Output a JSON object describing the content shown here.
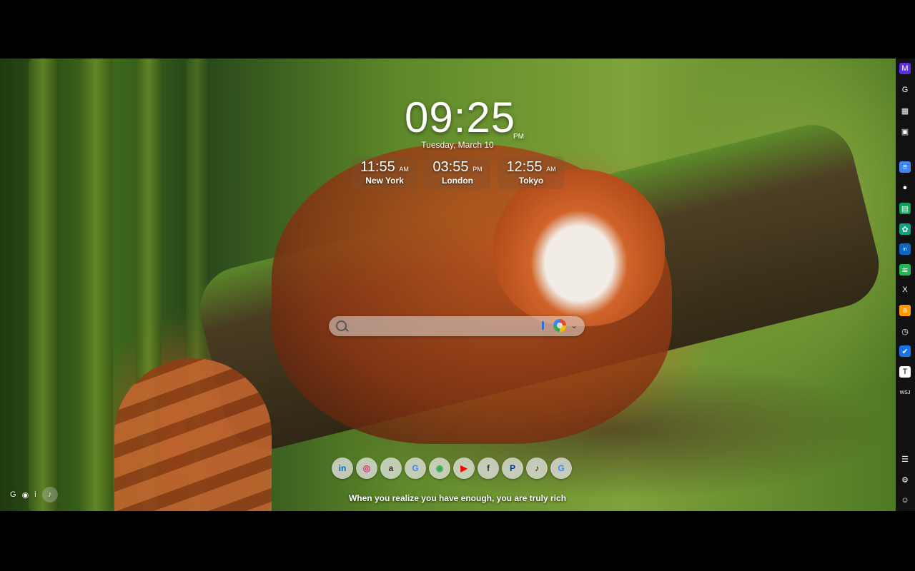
{
  "clock": {
    "time": "09:25",
    "ampm": "PM",
    "date": "Tuesday, March 10"
  },
  "world_clocks": [
    {
      "time": "11:55",
      "ampm": "AM",
      "city": "New York"
    },
    {
      "time": "03:55",
      "ampm": "PM",
      "city": "London"
    },
    {
      "time": "12:55",
      "ampm": "AM",
      "city": "Tokyo"
    }
  ],
  "search": {
    "placeholder": "",
    "engine_icon": "google-icon"
  },
  "dock": [
    {
      "name": "linkedin",
      "glyph": "in",
      "color": "#0a66c2"
    },
    {
      "name": "instagram",
      "glyph": "◎",
      "color": "#d62976"
    },
    {
      "name": "amazon",
      "glyph": "a",
      "color": "#333333"
    },
    {
      "name": "google",
      "glyph": "G",
      "color": "#4285f4"
    },
    {
      "name": "chrome",
      "glyph": "◉",
      "color": "#34a853"
    },
    {
      "name": "youtube",
      "glyph": "▶",
      "color": "#ff0000"
    },
    {
      "name": "facebook",
      "glyph": "f",
      "color": "#333333"
    },
    {
      "name": "paypal",
      "glyph": "P",
      "color": "#003087"
    },
    {
      "name": "tiktok",
      "glyph": "♪",
      "color": "#111111"
    },
    {
      "name": "google-2",
      "glyph": "G",
      "color": "#4285f4"
    }
  ],
  "quote": "When you realize you have enough, you are truly rich",
  "tools": {
    "google": "G",
    "eye": "◉",
    "info": "i",
    "music": "♪"
  },
  "sidebar": [
    {
      "name": "extension-logo-icon",
      "glyph": "M",
      "bg": "#5b2ee0"
    },
    {
      "name": "google-icon",
      "glyph": "G",
      "bg": "#111111"
    },
    {
      "name": "apps-icon",
      "glyph": "▦",
      "bg": "#111111"
    },
    {
      "name": "image-icon",
      "glyph": "▣",
      "bg": "#111111"
    },
    {
      "name": "google-docs-icon",
      "glyph": "≡",
      "bg": "#4285f4"
    },
    {
      "name": "google-maps-icon",
      "glyph": "●",
      "bg": "#111111"
    },
    {
      "name": "google-sheets-icon",
      "glyph": "▤",
      "bg": "#0f9d58"
    },
    {
      "name": "chatgpt-icon",
      "glyph": "✿",
      "bg": "#10a37f"
    },
    {
      "name": "linkedin-icon",
      "glyph": "in",
      "bg": "#0a66c2"
    },
    {
      "name": "spotify-icon",
      "glyph": "≋",
      "bg": "#1db954"
    },
    {
      "name": "x-icon",
      "glyph": "X",
      "bg": "#111111"
    },
    {
      "name": "amazon-icon",
      "glyph": "a",
      "bg": "#ff9900"
    },
    {
      "name": "timer-icon",
      "glyph": "◷",
      "bg": "#111111"
    },
    {
      "name": "tasks-icon",
      "glyph": "✔",
      "bg": "#1a73e8"
    },
    {
      "name": "nytimes-icon",
      "glyph": "T",
      "bg": "#ffffff"
    },
    {
      "name": "wsj-icon",
      "glyph": "WSJ",
      "bg": "#111111"
    },
    {
      "name": "list-icon",
      "glyph": "☰",
      "bg": "#111111"
    },
    {
      "name": "settings-icon",
      "glyph": "⚙",
      "bg": "#111111"
    },
    {
      "name": "profile-icon",
      "glyph": "☺",
      "bg": "#111111"
    }
  ]
}
